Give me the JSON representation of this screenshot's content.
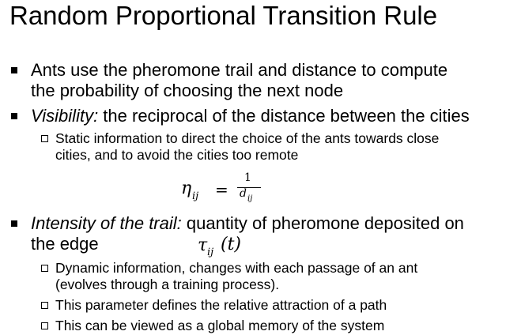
{
  "slide": {
    "title": "Random Proportional Transition Rule",
    "b1": {
      "line1": "Ants use the pheromone trail and distance to compute",
      "line2": "the probability of choosing the next node"
    },
    "b2": {
      "term": "Visibility:",
      "rest": " the reciprocal of the distance between the cities",
      "sub1": {
        "line1": "Static information to direct the choice of the ants towards close",
        "line2": "cities, and to avoid the cities too remote"
      },
      "formula": {
        "lhs_symbol": "η",
        "lhs_sub": "ij",
        "equals": "=",
        "numerator": "1",
        "den_symbol": "d",
        "den_sub": "ij"
      }
    },
    "b3": {
      "term": "Intensity of the trail:",
      "rest": " quantity of pheromone deposited on",
      "line2": "the edge",
      "formula": {
        "symbol": "τ",
        "sub": "ij",
        "arg": "(t)"
      },
      "subs": [
        {
          "line1": "Dynamic information, changes with each passage of an ant",
          "line2": "(evolves through a training process)."
        },
        {
          "line1": "This parameter defines the relative attraction of a path"
        },
        {
          "line1": "This can be viewed as a global memory of the system"
        }
      ]
    }
  }
}
